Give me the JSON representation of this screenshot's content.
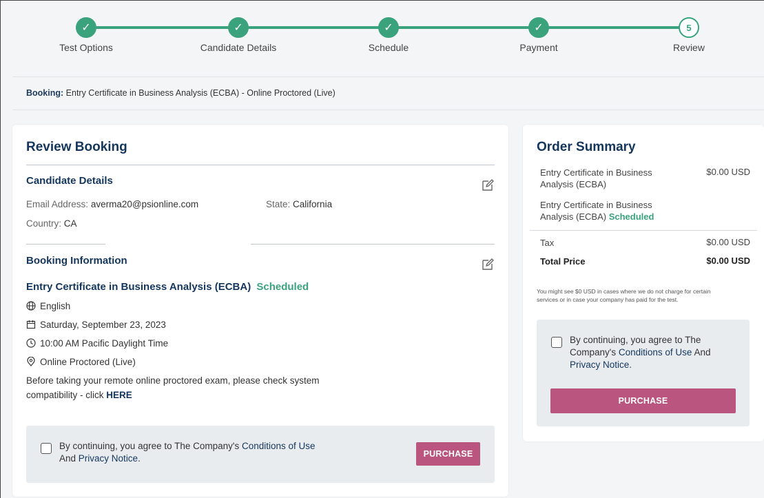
{
  "stepper": {
    "steps": [
      {
        "label": "Test Options",
        "mark": "✓"
      },
      {
        "label": "Candidate Details",
        "mark": "✓"
      },
      {
        "label": "Schedule",
        "mark": "✓"
      },
      {
        "label": "Payment",
        "mark": "✓"
      },
      {
        "label": "Review",
        "mark": "5"
      }
    ]
  },
  "booking": {
    "prefix": "Booking:",
    "value": "Entry Certificate in Business Analysis (ECBA) - Online Proctored (Live)"
  },
  "review": {
    "title": "Review Booking",
    "candidate_heading": "Candidate Details",
    "email_label": "Email Address:",
    "email_value": "averma20@psionline.com",
    "state_label": "State:",
    "state_value": "California",
    "country_label": "Country:",
    "country_value": "CA",
    "booking_heading": "Booking Information",
    "exam_name": "Entry Certificate in Business Analysis (ECBA)",
    "exam_status": "Scheduled",
    "language": "English",
    "date": "Saturday, September 23, 2023",
    "time": "10:00 AM Pacific Daylight Time",
    "delivery": "Online Proctored (Live)",
    "compat_line1": "Before taking your remote online proctored exam, please check system",
    "compat_line2": "compatibility - click",
    "compat_link": "HERE",
    "agree_pre": "By continuing, you agree to The Company's",
    "agree_link1": "Conditions of Use",
    "agree_and": "And",
    "agree_link2": "Privacy Notice",
    "agree_end": ".",
    "purchase_label": "PURCHASE"
  },
  "order": {
    "title": "Order Summary",
    "item1_name_l1": "Entry Certificate in Business",
    "item1_name_l2": "Analysis (ECBA)",
    "item1_price": "$0.00 USD",
    "item2_name_l1": "Entry Certificate in Business",
    "item2_name_l2": "Analysis (ECBA)",
    "item2_status": "Scheduled",
    "tax_label": "Tax",
    "tax_value": "$0.00 USD",
    "total_label": "Total Price",
    "total_value": "$0.00 USD",
    "note_l1": "You might see $0 USD in cases where we do not charge for certain",
    "note_l2": "services or in case your company has paid for the test.",
    "agree_pre": "By continuing, you agree to The",
    "agree_pre2": "Company's",
    "agree_link1": "Conditions of Use",
    "agree_and": "And",
    "agree_link2": "Privacy Notice",
    "agree_end": ".",
    "purchase_label": "PURCHASE"
  },
  "colors": {
    "accent_green": "#3aa37d",
    "heading_navy": "#14365d",
    "purchase_pink": "#b9557e"
  }
}
